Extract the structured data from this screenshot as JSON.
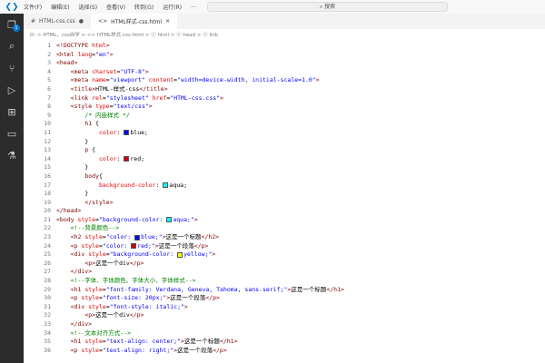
{
  "titlebar": {
    "menus": [
      "文件(F)",
      "编辑(E)",
      "选择(S)",
      "查看(V)",
      "转到(G)",
      "运行(R)",
      "···"
    ],
    "back": "←",
    "forward": "→",
    "search": "⌕ 搜索"
  },
  "activity": {
    "icons": [
      "files-icon",
      "search-icon",
      "source-control-icon",
      "run-debug-icon",
      "extensions-icon",
      "remote-explorer-icon",
      "testing-icon"
    ],
    "badge": "1"
  },
  "tabs": [
    {
      "label": "HTML-css.css",
      "icon": "#",
      "status": "●"
    },
    {
      "label": "HTML样式-css.html",
      "icon": "<>",
      "status": "×",
      "active": true
    }
  ],
  "breadcrumb": "D: > HTML、css自学 > <> HTML样式-css.html > ⓔ html > ⓔ head > ⓔ link",
  "colors": {
    "blue": "#0000ff",
    "red": "#cc0000",
    "aqua": "#00ffff",
    "yellow": "#ffff00"
  },
  "lines": [
    [
      [
        "tag",
        "<!DOCTYPE "
      ],
      [
        "attr",
        "html"
      ],
      [
        "tag",
        ">"
      ]
    ],
    [
      [
        "tag",
        "<html "
      ],
      [
        "attr",
        "lang"
      ],
      [
        "txt",
        "="
      ],
      [
        "val",
        "\"en\""
      ],
      [
        "tag",
        ">"
      ]
    ],
    [
      [
        "tag",
        "<head>"
      ]
    ],
    [
      [
        "txt",
        "    "
      ],
      [
        "tag",
        "<meta "
      ],
      [
        "attr",
        "charset"
      ],
      [
        "txt",
        "="
      ],
      [
        "val",
        "\"UTF-8\""
      ],
      [
        "tag",
        ">"
      ]
    ],
    [
      [
        "txt",
        "    "
      ],
      [
        "tag",
        "<meta "
      ],
      [
        "attr",
        "name"
      ],
      [
        "txt",
        "="
      ],
      [
        "val",
        "\"viewport\""
      ],
      [
        "attr",
        " content"
      ],
      [
        "txt",
        "="
      ],
      [
        "val",
        "\"width=device-width, initial-scale=1.0\""
      ],
      [
        "tag",
        ">"
      ]
    ],
    [
      [
        "txt",
        "    "
      ],
      [
        "tag",
        "<title>"
      ],
      [
        "txt",
        "HTML-样式-css"
      ],
      [
        "tag",
        "</title>"
      ]
    ],
    [
      [
        "txt",
        "    "
      ],
      [
        "tag",
        "<link "
      ],
      [
        "attr",
        "rel"
      ],
      [
        "txt",
        "="
      ],
      [
        "val",
        "\"stylesheet\""
      ],
      [
        "attr",
        " href"
      ],
      [
        "txt",
        "="
      ],
      [
        "val",
        "\"HTML-css.css\""
      ],
      [
        "tag",
        ">"
      ]
    ],
    [
      [
        "txt",
        "    "
      ],
      [
        "tag",
        "<style "
      ],
      [
        "attr",
        "type"
      ],
      [
        "txt",
        "="
      ],
      [
        "val",
        "\"text/css\""
      ],
      [
        "tag",
        ">"
      ]
    ],
    [
      [
        "txt",
        "        "
      ],
      [
        "com",
        "/* 内嵌样式 */"
      ]
    ],
    [
      [
        "txt",
        "        "
      ],
      [
        "tag",
        "h1"
      ],
      [
        "txt",
        " {"
      ]
    ],
    [
      [
        "txt",
        "            "
      ],
      [
        "prop",
        "color"
      ],
      [
        "txt",
        ": "
      ],
      [
        "sw",
        "blue"
      ],
      [
        "txt",
        "blue;"
      ]
    ],
    [
      [
        "txt",
        "        }"
      ]
    ],
    [
      [
        "txt",
        "        "
      ],
      [
        "tag",
        "p"
      ],
      [
        "txt",
        " {"
      ]
    ],
    [
      [
        "txt",
        "            "
      ],
      [
        "prop",
        "color"
      ],
      [
        "txt",
        ": "
      ],
      [
        "sw",
        "red"
      ],
      [
        "txt",
        "red;"
      ]
    ],
    [
      [
        "txt",
        "        }"
      ]
    ],
    [
      [
        "txt",
        "        "
      ],
      [
        "tag",
        "body"
      ],
      [
        "txt",
        "{"
      ]
    ],
    [
      [
        "txt",
        "            "
      ],
      [
        "prop",
        "background-color"
      ],
      [
        "txt",
        ": "
      ],
      [
        "sw",
        "aqua"
      ],
      [
        "txt",
        "aqua;"
      ]
    ],
    [
      [
        "txt",
        "        }"
      ]
    ],
    [
      [
        "txt",
        "        "
      ],
      [
        "tag",
        "</style>"
      ]
    ],
    [
      [
        "tag",
        "</head>"
      ]
    ],
    [
      [
        "tag",
        "<body "
      ],
      [
        "attr",
        "style"
      ],
      [
        "txt",
        "="
      ],
      [
        "val",
        "\"background-color: "
      ],
      [
        "sw",
        "aqua"
      ],
      [
        "val",
        "aqua;\""
      ],
      [
        "tag",
        ">"
      ]
    ],
    [
      [
        "txt",
        "    "
      ],
      [
        "com",
        "<!--背景颜色-->"
      ]
    ],
    [
      [
        "txt",
        "    "
      ],
      [
        "tag",
        "<h2 "
      ],
      [
        "attr",
        "style"
      ],
      [
        "txt",
        "="
      ],
      [
        "val",
        "\"color: "
      ],
      [
        "sw",
        "blue"
      ],
      [
        "val",
        "blue;\""
      ],
      [
        "tag",
        ">"
      ],
      [
        "txt",
        "这是一个标题"
      ],
      [
        "tag",
        "</h2>"
      ]
    ],
    [
      [
        "txt",
        "    "
      ],
      [
        "tag",
        "<p "
      ],
      [
        "attr",
        "style"
      ],
      [
        "txt",
        "="
      ],
      [
        "val",
        "\"color: "
      ],
      [
        "sw",
        "red"
      ],
      [
        "val",
        "red;\""
      ],
      [
        "tag",
        ">"
      ],
      [
        "txt",
        "这是一个段落"
      ],
      [
        "tag",
        "</p>"
      ]
    ],
    [
      [
        "txt",
        "    "
      ],
      [
        "tag",
        "<div "
      ],
      [
        "attr",
        "style"
      ],
      [
        "txt",
        "="
      ],
      [
        "val",
        "\"background-color: "
      ],
      [
        "sw",
        "yellow"
      ],
      [
        "val",
        "yellow;\""
      ],
      [
        "tag",
        ">"
      ]
    ],
    [
      [
        "txt",
        "        "
      ],
      [
        "tag",
        "<p>"
      ],
      [
        "txt",
        "这是一个div"
      ],
      [
        "tag",
        "</p>"
      ]
    ],
    [
      [
        "txt",
        "    "
      ],
      [
        "tag",
        "</div>"
      ]
    ],
    [
      [
        "txt",
        "    "
      ],
      [
        "com",
        "<!--字体、字体颜色、字体大小、字体样式-->"
      ]
    ],
    [
      [
        "txt",
        "    "
      ],
      [
        "tag",
        "<h1 "
      ],
      [
        "attr",
        "style"
      ],
      [
        "txt",
        "="
      ],
      [
        "val",
        "\"font-family: Verdana, Geneva, Tahoma, sans-serif;\""
      ],
      [
        "tag",
        ">"
      ],
      [
        "txt",
        "这是一个标题"
      ],
      [
        "tag",
        "</h1>"
      ]
    ],
    [
      [
        "txt",
        "    "
      ],
      [
        "tag",
        "<p "
      ],
      [
        "attr",
        "style"
      ],
      [
        "txt",
        "="
      ],
      [
        "val",
        "\"font-size: 20px;\""
      ],
      [
        "tag",
        ">"
      ],
      [
        "txt",
        "这是一个段落"
      ],
      [
        "tag",
        "</p>"
      ]
    ],
    [
      [
        "txt",
        "    "
      ],
      [
        "tag",
        "<div "
      ],
      [
        "attr",
        "style"
      ],
      [
        "txt",
        "="
      ],
      [
        "val",
        "\"font-style: italic;\""
      ],
      [
        "tag",
        ">"
      ]
    ],
    [
      [
        "txt",
        "        "
      ],
      [
        "tag",
        "<p>"
      ],
      [
        "txt",
        "这是一个div"
      ],
      [
        "tag",
        "</p>"
      ]
    ],
    [
      [
        "txt",
        "    "
      ],
      [
        "tag",
        "</div>"
      ]
    ],
    [
      [
        "txt",
        "    "
      ],
      [
        "com",
        "<!--文本对齐方式-->"
      ]
    ],
    [
      [
        "txt",
        "    "
      ],
      [
        "tag",
        "<h1 "
      ],
      [
        "attr",
        "style"
      ],
      [
        "txt",
        "="
      ],
      [
        "val",
        "\"text-align: center;\""
      ],
      [
        "tag",
        ">"
      ],
      [
        "txt",
        "这是一个标题"
      ],
      [
        "tag",
        "</h1>"
      ]
    ],
    [
      [
        "txt",
        "    "
      ],
      [
        "tag",
        "<p "
      ],
      [
        "attr",
        "style"
      ],
      [
        "txt",
        "="
      ],
      [
        "val",
        "\"text-align: right;\""
      ],
      [
        "tag",
        ">"
      ],
      [
        "txt",
        "这是一个段落"
      ],
      [
        "tag",
        "</p>"
      ]
    ]
  ]
}
